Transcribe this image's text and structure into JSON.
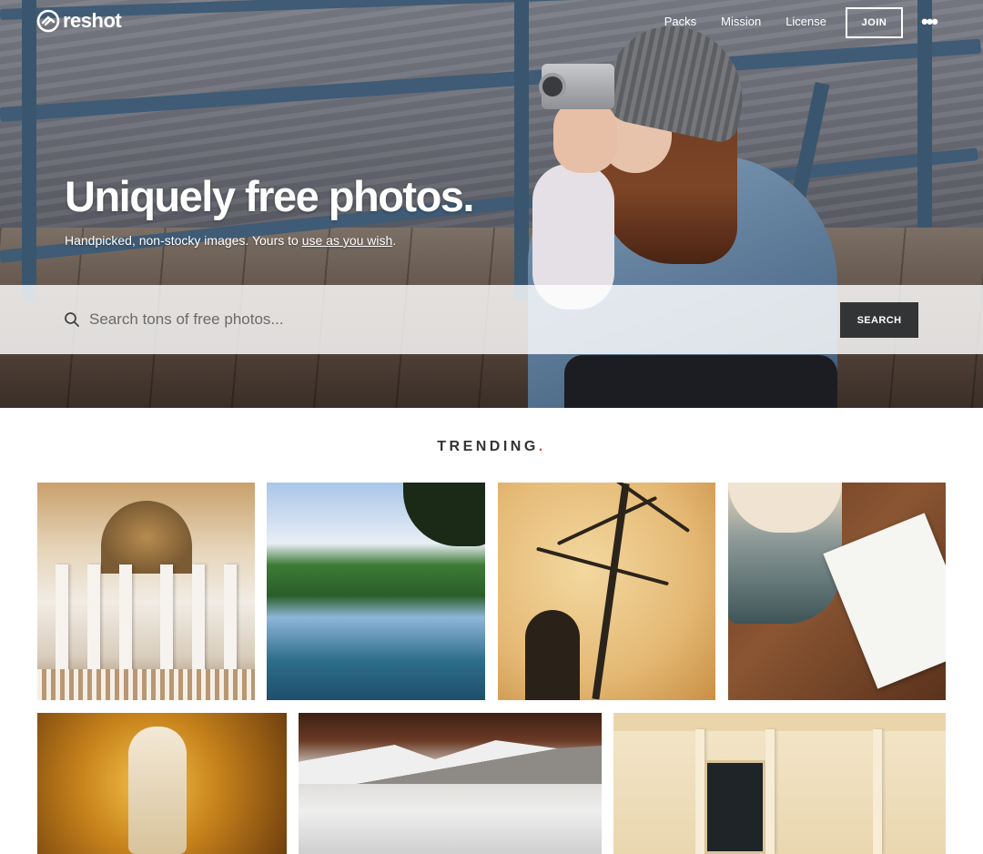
{
  "nav": {
    "logo_text": "reshot",
    "links": [
      "Packs",
      "Mission",
      "License"
    ],
    "join_label": "JOIN",
    "more_label": "•••"
  },
  "hero": {
    "headline": "Uniquely free photos.",
    "subline_prefix": "Handpicked, non-stocky images. Yours to ",
    "subline_link": "use as you wish",
    "subline_suffix": ".",
    "search_placeholder": "Search tons of free photos...",
    "search_button": "SEARCH"
  },
  "trending": {
    "title": "TRENDING",
    "dot": "."
  },
  "colors": {
    "accent_dot": "#e8483b",
    "search_button_bg": "#333436"
  },
  "icons": {
    "logo": "reshot-logo-icon",
    "search": "search-icon",
    "more": "more-dots-icon"
  }
}
